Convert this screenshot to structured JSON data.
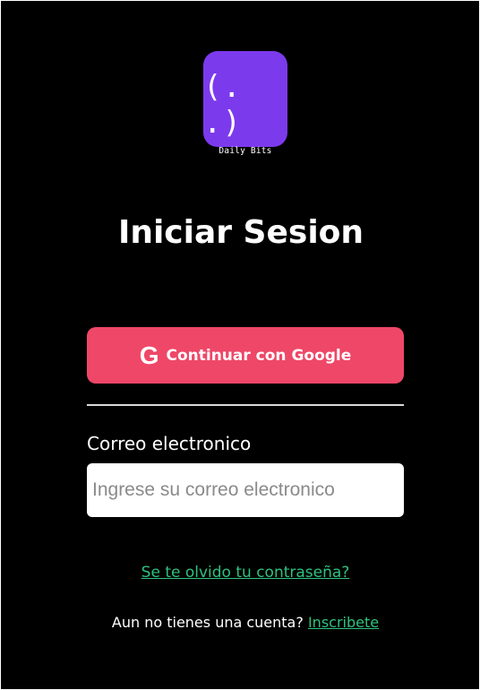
{
  "logo": {
    "face": "(. .)",
    "text": "Daily Bits",
    "color": "#7c3aed"
  },
  "title": "Iniciar Sesion",
  "google_button": {
    "icon": "google-icon",
    "icon_glyph": "G",
    "label": "Continuar con Google",
    "color": "#ef4768"
  },
  "email": {
    "label": "Correo electronico",
    "value": "",
    "placeholder": "Ingrese su correo electronico"
  },
  "forgot_password": "Se te olvido tu contraseña?",
  "signup": {
    "prompt": "Aun no tienes una cuenta?",
    "link": "Inscribete",
    "link_color": "#2ec27e"
  }
}
